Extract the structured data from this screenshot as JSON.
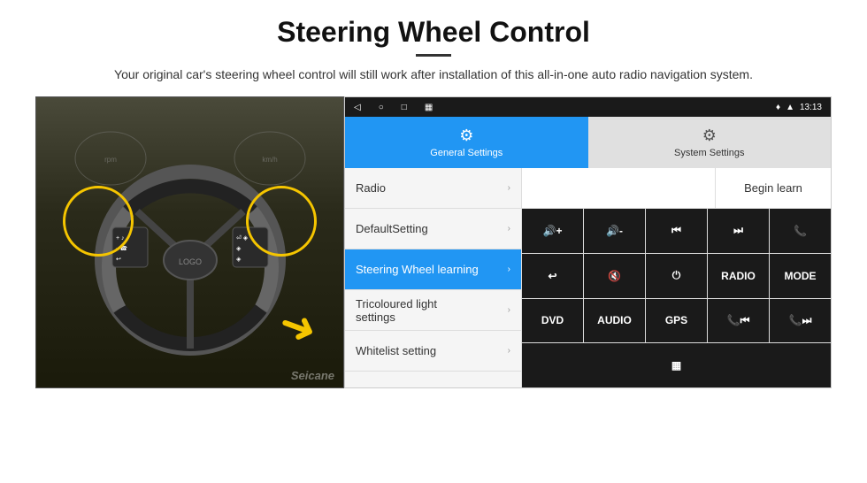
{
  "header": {
    "title": "Steering Wheel Control",
    "subtitle": "Your original car's steering wheel control will still work after installation of this all-in-one auto radio navigation system."
  },
  "status_bar": {
    "time": "13:13",
    "signal_icon": "signal",
    "wifi_icon": "wifi"
  },
  "tabs": [
    {
      "label": "General Settings",
      "active": true
    },
    {
      "label": "System Settings",
      "active": false
    }
  ],
  "menu_items": [
    {
      "label": "Radio",
      "active": false
    },
    {
      "label": "DefaultSetting",
      "active": false
    },
    {
      "label": "Steering Wheel learning",
      "active": true
    },
    {
      "label": "Tricoloured light settings",
      "active": false
    },
    {
      "label": "Whitelist setting",
      "active": false
    }
  ],
  "panel": {
    "begin_learn_label": "Begin learn"
  },
  "buttons": {
    "row1": [
      "🔊+",
      "🔊-",
      "⏮",
      "⏭",
      "📞"
    ],
    "row2": [
      "↩",
      "🔇",
      "⏻",
      "RADIO",
      "MODE"
    ],
    "row3": [
      "DVD",
      "AUDIO",
      "GPS",
      "📞⏮",
      "📞⏭"
    ],
    "row4": [
      "≡"
    ]
  },
  "watermark": "Seicane"
}
